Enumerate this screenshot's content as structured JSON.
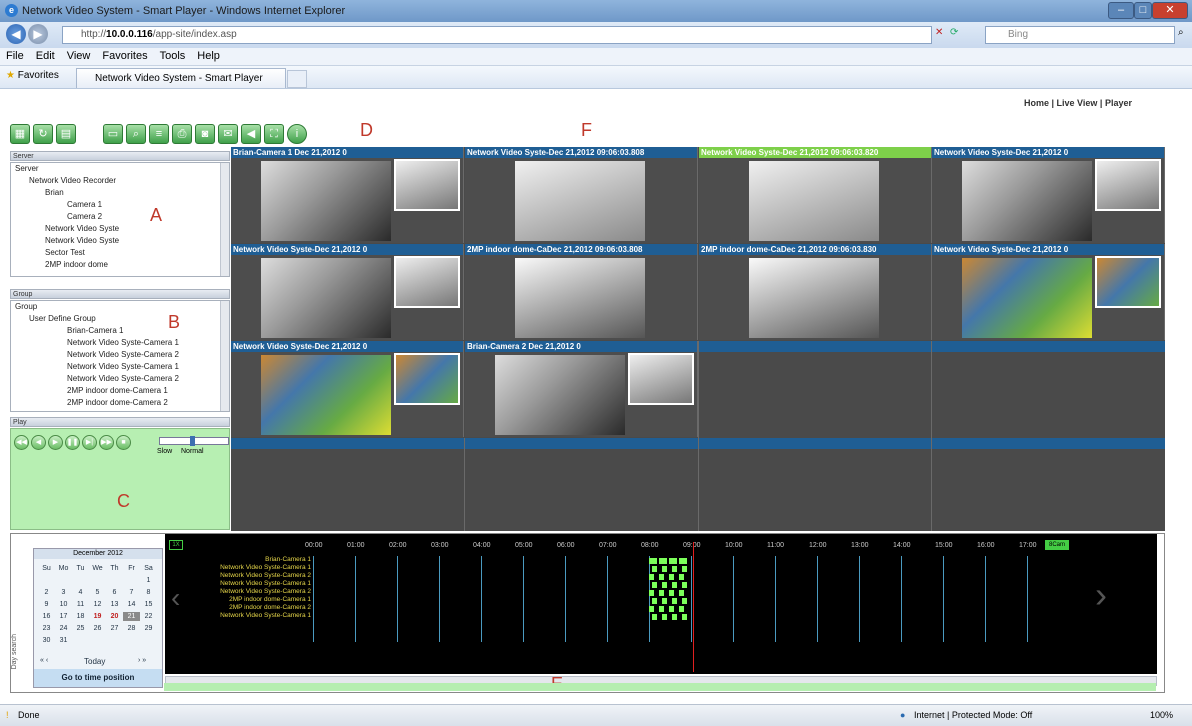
{
  "window": {
    "title": "Network Video System - Smart Player - Windows Internet Explorer",
    "min_label": "–",
    "max_label": "□",
    "close_label": "✕"
  },
  "address": {
    "url_host": "10.0.0.116",
    "url_prefix": "http://",
    "url_path": "/app-site/index.asp",
    "search_placeholder": "Bing"
  },
  "menu": [
    "File",
    "Edit",
    "View",
    "Favorites",
    "Tools",
    "Help"
  ],
  "favorites": {
    "label": "Favorites",
    "tab_title": "Network Video System - Smart Player"
  },
  "toplinks": {
    "home": "Home",
    "live": "Live View",
    "player": "Player",
    "sep": "|"
  },
  "annotations": {
    "a": "A",
    "b": "B",
    "c": "C",
    "d": "D",
    "e": "E",
    "f": "F"
  },
  "server_panel": {
    "header": "Server",
    "items": [
      "Server",
      "Network Video Recorder",
      "Brian",
      "Camera 1",
      "Camera 2",
      "Network Video Syste",
      "Network Video Syste",
      "Sector Test",
      "2MP indoor dome"
    ]
  },
  "group_panel": {
    "header": "Group",
    "items": [
      "Group",
      "User Define Group",
      "Brian-Camera 1",
      "Network Video Syste-Camera 1",
      "Network Video Syste-Camera 2",
      "Network Video Syste-Camera 1",
      "Network Video Syste-Camera 2",
      "2MP indoor dome-Camera 1",
      "2MP indoor dome-Camera 2"
    ]
  },
  "play_panel": {
    "header": "Play",
    "speed_slow": "Slow",
    "speed_normal": "Normal"
  },
  "video_cells": [
    {
      "title": "Brian-Camera 1      Dec 21,2012 0"
    },
    {
      "title": "Network Video Syste-Dec 21,2012 09:06:03.808"
    },
    {
      "title": "Network Video Syste-Dec 21,2012 09:06:03.820"
    },
    {
      "title": "Network Video Syste-Dec 21,2012 0"
    },
    {
      "title": "Network Video Syste-Dec 21,2012 0"
    },
    {
      "title": "2MP indoor dome-CaDec 21,2012 09:06:03.808"
    },
    {
      "title": "2MP indoor dome-CaDec 21,2012 09:06:03.830"
    },
    {
      "title": "Network Video Syste-Dec 21,2012 0"
    },
    {
      "title": "Network Video Syste-Dec 21,2012 0"
    },
    {
      "title": "Brian-Camera 2      Dec 21,2012 0"
    }
  ],
  "calendar": {
    "title": "December 2012",
    "days": [
      "Su",
      "Mo",
      "Tu",
      "We",
      "Th",
      "Fr",
      "Sa"
    ],
    "dates": [
      "",
      "",
      "",
      "",
      "",
      "",
      "1",
      "2",
      "3",
      "4",
      "5",
      "6",
      "7",
      "8",
      "9",
      "10",
      "11",
      "12",
      "13",
      "14",
      "15",
      "16",
      "17",
      "18",
      "19",
      "20",
      "21",
      "22",
      "23",
      "24",
      "25",
      "26",
      "27",
      "28",
      "29",
      "30",
      "31"
    ],
    "today": "Today",
    "prev": "«  ‹",
    "next": "›  »",
    "goto": "Go to time position",
    "side_label": "Day search"
  },
  "timeline": {
    "zoom_labels": [
      "1X"
    ],
    "hours": [
      "00:00",
      "01:00",
      "02:00",
      "03:00",
      "04:00",
      "05:00",
      "06:00",
      "07:00",
      "08:00",
      "09:00",
      "10:00",
      "11:00",
      "12:00",
      "13:00",
      "14:00",
      "15:00",
      "16:00",
      "17:00"
    ],
    "rows": [
      "Brian-Camera 1",
      "Network Video Syste-Camera 1",
      "Network Video Syste-Camera 2",
      "Network Video Syste-Camera 1",
      "Network Video Syste-Camera 2",
      "2MP indoor dome-Camera 1",
      "2MP indoor dome-Camera 2",
      "Network Video Syste-Camera 1"
    ],
    "right_btn": "8Cam"
  },
  "status": {
    "left": "Done",
    "zone": "Internet | Protected Mode: Off",
    "zoom": "100%"
  }
}
